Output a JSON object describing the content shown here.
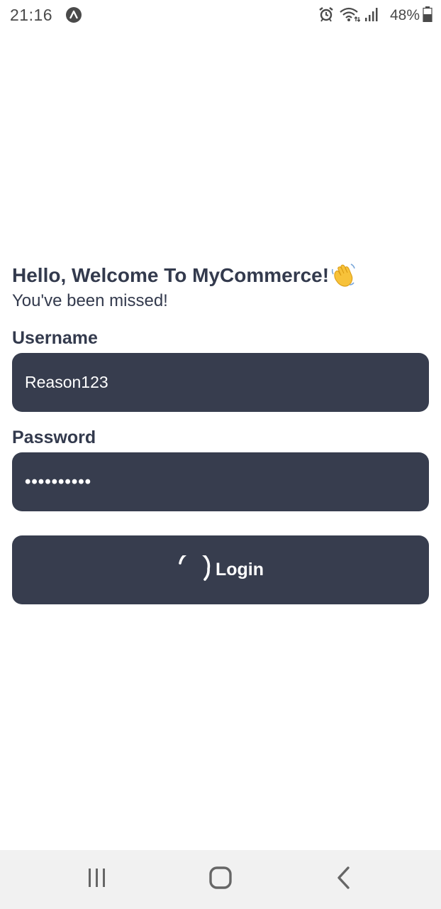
{
  "status_bar": {
    "time": "21:16",
    "battery_percent": "48%",
    "icons": [
      "app-notification-icon",
      "alarm-icon",
      "wifi-icon",
      "signal-icon",
      "battery-icon"
    ]
  },
  "login": {
    "title": "Hello, Welcome To MyCommerce!",
    "title_emoji_icon": "waving-hand-icon",
    "subtitle": "You've been missed!",
    "username_label": "Username",
    "username_value": "Reason123",
    "password_label": "Password",
    "password_value": "••••••••••",
    "login_label": "Login",
    "loading": true
  },
  "nav_bar": {
    "buttons": [
      "recent-apps-icon",
      "home-icon",
      "back-icon"
    ]
  },
  "colors": {
    "primary_dark": "#373d4e",
    "text_dark": "#333a4d",
    "background": "#ffffff",
    "nav_background": "#f1f1f1"
  }
}
